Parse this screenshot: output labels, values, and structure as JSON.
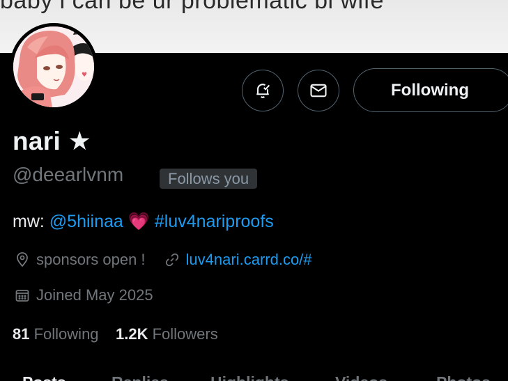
{
  "banner": {
    "text": "baby i can be ur problematic bi wife"
  },
  "actions": {
    "following_label": "Following"
  },
  "profile": {
    "name": "nari",
    "name_symbol": "★",
    "handle": "@deearlvnm",
    "follows_you": "Follows you",
    "bio": {
      "prefix": "mw: ",
      "mention": "@5hiinaa",
      "emoji": "💗",
      "hashtag": "#luv4nariproofs"
    },
    "location": "sponsors open !",
    "website": "luv4nari.carrd.co/#",
    "joined": "Joined May 2025",
    "following_count": "81",
    "following_label": "Following",
    "followers_count": "1.2K",
    "followers_label": "Followers"
  },
  "tabs": [
    "Posts",
    "Replies",
    "Highlights",
    "Videos",
    "Photos"
  ],
  "colors": {
    "accent": "#1d9bf0",
    "muted": "#71767b",
    "border": "#536471"
  }
}
